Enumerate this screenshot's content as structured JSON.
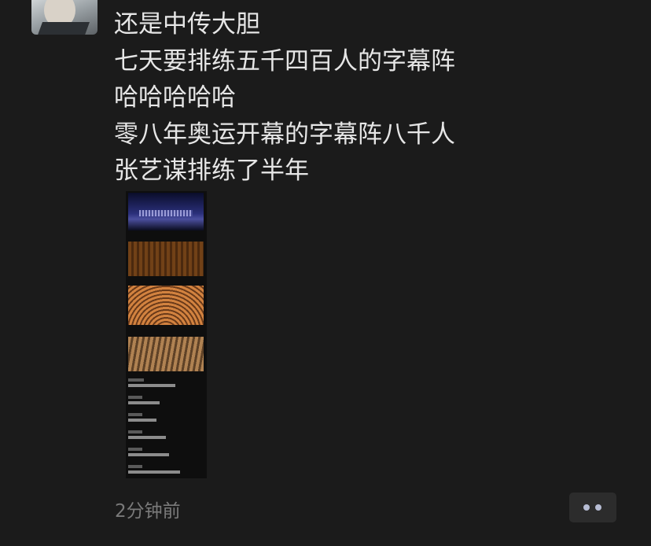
{
  "post": {
    "lines": [
      "还是中传大胆",
      "七天要排练五千四百人的字幕阵",
      "哈哈哈哈哈",
      "零八年奥运开幕的字幕阵八千人",
      "张艺谋排练了半年"
    ],
    "time": "2分钟前"
  },
  "icons": {
    "more": "more-dots-icon"
  },
  "colors": {
    "background": "#1b1b1b",
    "text": "#e6e6e6",
    "time": "#7a7a7a",
    "more_button_bg": "#2c2c2c",
    "dots": "#b7bdd4"
  }
}
